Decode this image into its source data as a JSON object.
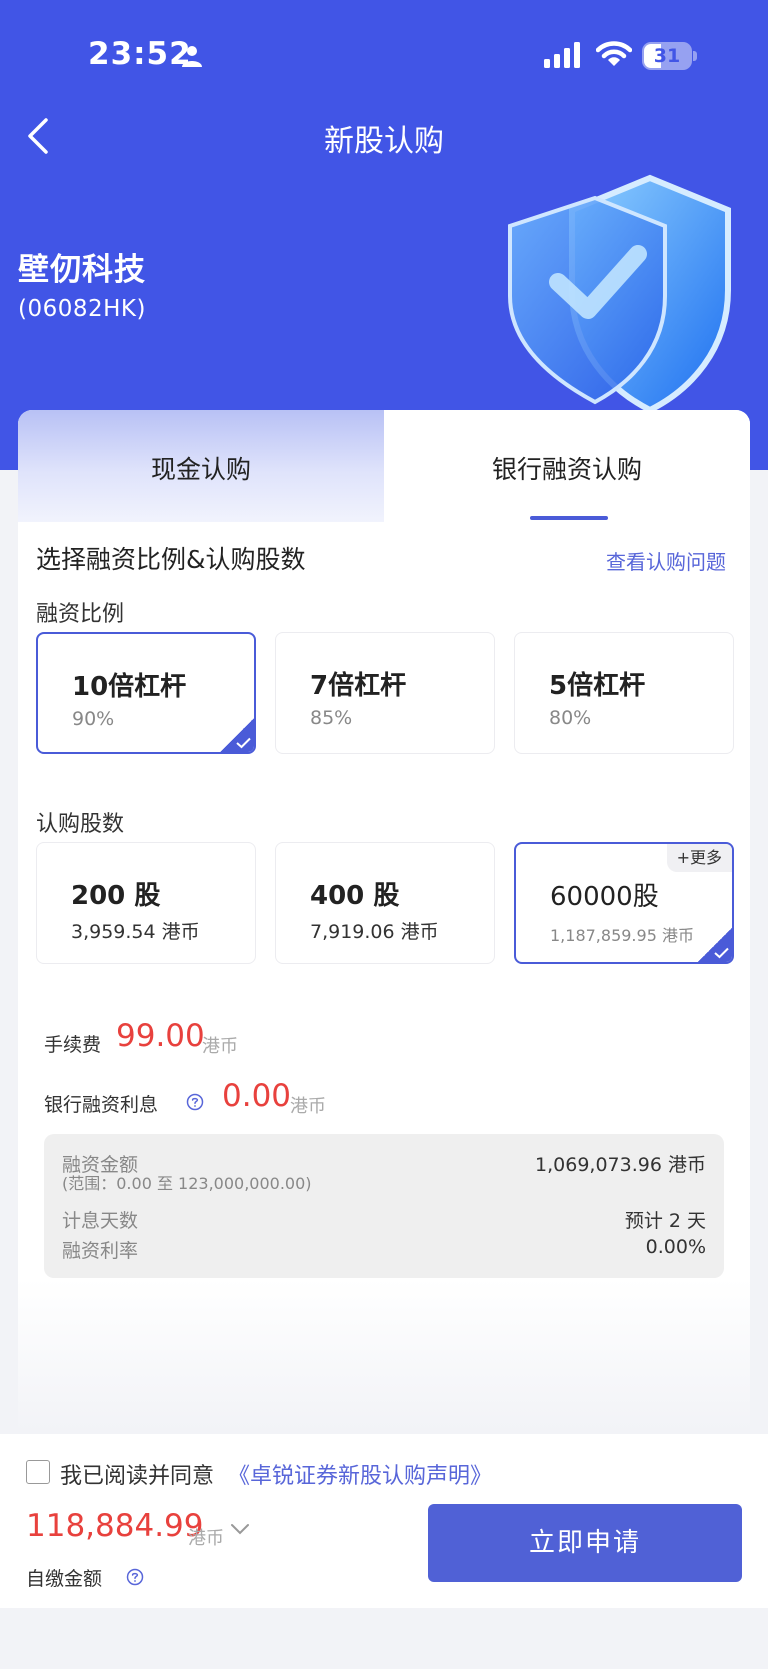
{
  "status_bar": {
    "time": "23:52",
    "battery": "31"
  },
  "nav": {
    "title": "新股认购"
  },
  "stock": {
    "name": "壁仞科技",
    "code": "(06082HK)"
  },
  "tabs": [
    {
      "label": "现金认购",
      "selected": false
    },
    {
      "label": "银行融资认购",
      "selected": true
    }
  ],
  "section": {
    "title": "选择融资比例&认购股数",
    "faq_link": "查看认购问题"
  },
  "ratio": {
    "label": "融资比例",
    "options": [
      {
        "main": "10倍杠杆",
        "sub": "90%",
        "selected": true
      },
      {
        "main": "7倍杠杆",
        "sub": "85%",
        "selected": false
      },
      {
        "main": "5倍杠杆",
        "sub": "80%",
        "selected": false
      }
    ]
  },
  "shares": {
    "label": "认购股数",
    "more_tag": "+更多",
    "options": [
      {
        "main": "200 股",
        "sub": "3,959.54 港币",
        "selected": false
      },
      {
        "main": "400 股",
        "sub": "7,919.06 港币",
        "selected": false
      },
      {
        "main": "60000股",
        "sub": "1,187,859.95 港币",
        "selected": true
      }
    ]
  },
  "fee": {
    "label": "手续费",
    "value": "99.00",
    "unit": "港币"
  },
  "interest": {
    "label": "银行融资利息",
    "value": "0.00",
    "unit": "港币"
  },
  "details": {
    "amount_label": "融资金额",
    "amount_value": "1,069,073.96 港币",
    "range": "(范围：0.00 至 123,000,000.00)",
    "days_label": "计息天数",
    "days_value": "预计 2 天",
    "rate_label": "融资利率",
    "rate_value": "0.00%"
  },
  "footer": {
    "agree_text": "我已阅读并同意",
    "agree_link": "《卓锐证券新股认购声明》",
    "total": "118,884.99",
    "total_unit": "港币",
    "self_label": "自缴金额",
    "apply_label": "立即申请"
  },
  "colors": {
    "brand": "#4155e6",
    "accent": "#4a5bd8",
    "price_red": "#e8413d"
  },
  "icons": [
    "person-icon",
    "signal-icon",
    "wifi-icon",
    "battery-icon",
    "back-icon",
    "shield-icon",
    "help-icon",
    "check-icon",
    "chevron-down-icon"
  ]
}
